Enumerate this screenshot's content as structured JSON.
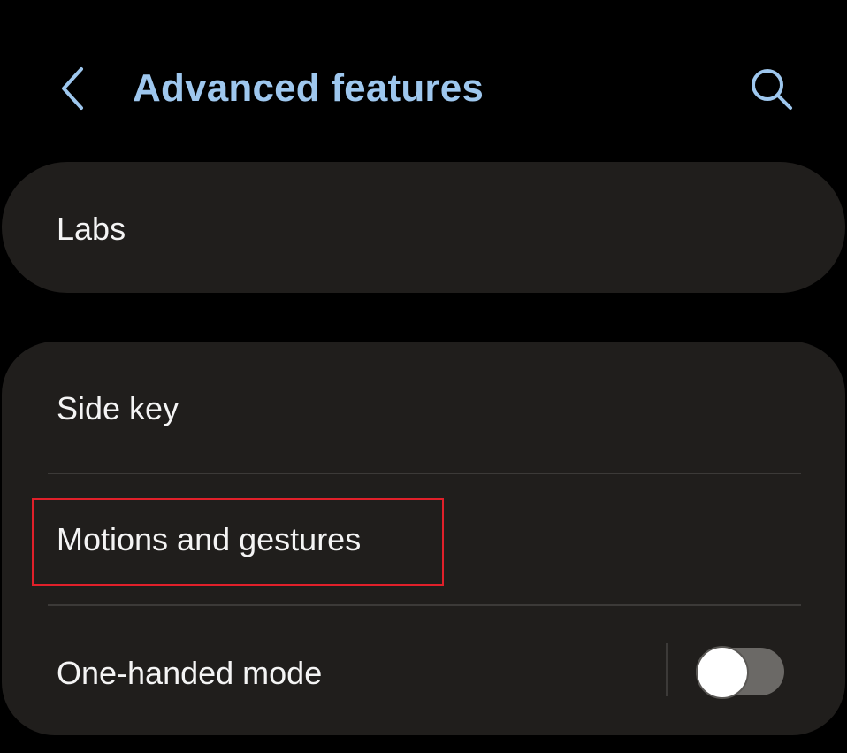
{
  "colors": {
    "accent": "#9ec7ee",
    "card": "#201e1c",
    "background": "#000000",
    "highlight": "#e0202a"
  },
  "header": {
    "title": "Advanced features",
    "back_icon": "chevron-left-icon",
    "search_icon": "search-icon"
  },
  "cards": {
    "labs": {
      "label": "Labs"
    },
    "main": {
      "items": [
        {
          "label": "Side key"
        },
        {
          "label": "Motions and gestures",
          "highlighted": true
        },
        {
          "label": "One-handed mode",
          "toggle": false
        }
      ]
    }
  }
}
